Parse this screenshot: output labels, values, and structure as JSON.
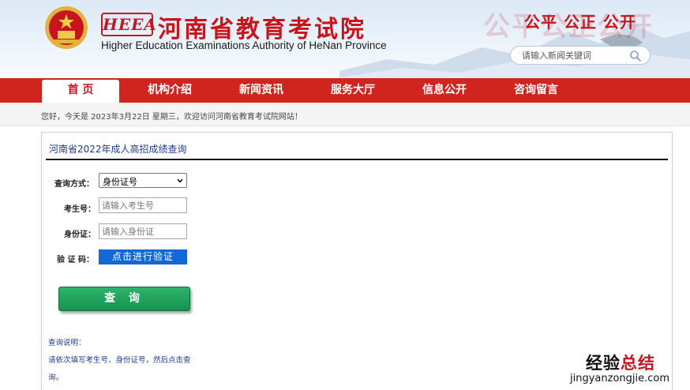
{
  "header": {
    "logo_mark": "HEEA",
    "site_title": "河南省教育考试院",
    "site_subtitle": "Higher Education Examinations Authority of HeNan Province",
    "slogan_ghost": "公平公正公开",
    "slogan": "公平 公正 公开",
    "search_placeholder": "请输入新闻关键词"
  },
  "nav": {
    "items": [
      {
        "label": "首  页"
      },
      {
        "label": "机构介绍"
      },
      {
        "label": "新闻资讯"
      },
      {
        "label": "服务大厅"
      },
      {
        "label": "信息公开"
      },
      {
        "label": "咨询留言"
      }
    ],
    "active_index": 0
  },
  "welcome": {
    "text": "您好，今天是 2023年3月22日 星期三，欢迎访问河南省教育考试院网站！"
  },
  "panel": {
    "title": "河南省2022年成人高招成绩查询",
    "form": {
      "query_mode_label": "查询方式：",
      "query_mode_value": "身份证号",
      "exam_no_label": "考生号：",
      "exam_no_placeholder": "请输入考生号",
      "id_label": "身份证：",
      "id_placeholder": "请输入身份证",
      "captcha_label": "验 证 码：",
      "captcha_button": "点击进行验证",
      "submit_button": "查 询"
    },
    "notes": {
      "heading": "查询说明：",
      "line1": "请依次填写考生号、身份证号，然后点击查",
      "line2": "询。"
    }
  },
  "watermark": {
    "title_part1": "经验",
    "title_part2": "总结",
    "url": "jingyanzongjie.com"
  },
  "colors": {
    "brand_red": "#c8151d",
    "nav_red": "#d0251f",
    "title_blue": "#1f3b8c",
    "verify_blue": "#1468d6",
    "submit_green": "#17924e"
  }
}
